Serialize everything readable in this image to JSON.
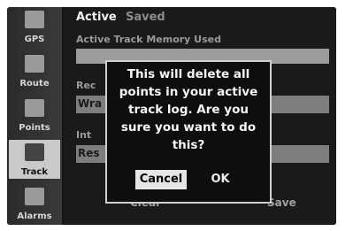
{
  "sidebar": {
    "items": [
      {
        "label": "GPS",
        "icon": "satellite-icon"
      },
      {
        "label": "Route",
        "icon": "route-icon"
      },
      {
        "label": "Points",
        "icon": "points-icon"
      },
      {
        "label": "Track",
        "icon": "track-icon"
      },
      {
        "label": "Alarms",
        "icon": "alarm-icon"
      }
    ]
  },
  "tabs": [
    "Active",
    "Saved"
  ],
  "main": {
    "memory_label": "Active Track Memory Used",
    "record_label": "Rec",
    "record_value": "Wra",
    "interval_label": "Int",
    "interval_value": "Res"
  },
  "buttons": {
    "clear": "Clear",
    "save": "Save"
  },
  "dialog": {
    "message": "This will delete all points in your active track log. Are you sure you want to do this?",
    "cancel": "Cancel",
    "ok": "OK"
  }
}
